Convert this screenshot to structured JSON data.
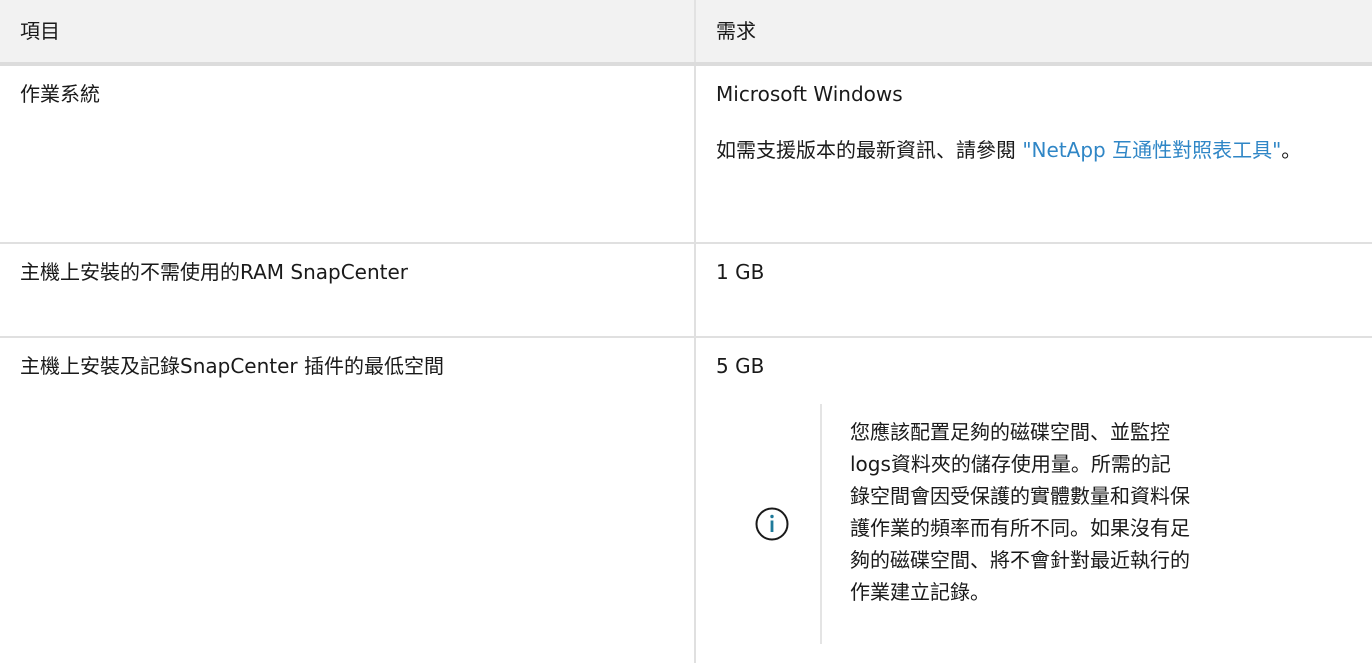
{
  "table": {
    "headers": [
      "項目",
      "需求"
    ],
    "rows": [
      {
        "item": "作業系統",
        "requirement": "Microsoft Windows",
        "note_prefix": "如需支援版本的最新資訊、請參閱 ",
        "note_link": "\"NetApp 互通性對照表工具\"",
        "note_suffix": "。"
      },
      {
        "item": "主機上安裝的不需使用的RAM SnapCenter",
        "requirement": "1 GB"
      },
      {
        "item": "主機上安裝及記錄SnapCenter 插件的最低空間",
        "requirement": "5 GB",
        "admonition": {
          "icon": "info-circle-icon",
          "text": "您應該配置足夠的磁碟空間、並監控logs資料夾的儲存使用量。所需的記錄空間會因受保護的實體數量和資料保護作業的頻率而有所不同。如果沒有足夠的磁碟空間、將不會針對最近執行的作業建立記錄。"
        }
      }
    ]
  },
  "colors": {
    "link": "#2f86c6",
    "header_bg": "#f2f2f2",
    "icon": "#1f7a9a"
  }
}
